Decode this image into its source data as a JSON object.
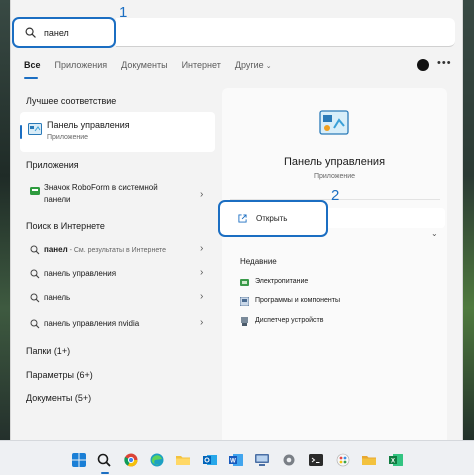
{
  "search": {
    "value": "панел",
    "step_label": "1"
  },
  "tabs": [
    {
      "label": "Все"
    },
    {
      "label": "Приложения"
    },
    {
      "label": "Документы"
    },
    {
      "label": "Интернет"
    },
    {
      "label": "Другие"
    }
  ],
  "more_label": "•••",
  "best_match": {
    "heading": "Лучшее соответствие",
    "title": "Панель управления",
    "subtitle": "Приложение"
  },
  "apps": {
    "heading": "Приложения",
    "items": [
      {
        "label": "Значок RoboForm в системной панели",
        "line1": "Значок RoboForm в системной",
        "line2": "панели"
      }
    ]
  },
  "web": {
    "heading": "Поиск в Интернете",
    "items": [
      {
        "bold": "панел",
        "rest": " - См. результаты в Интернете"
      },
      {
        "bold": "панель управления",
        "rest": ""
      },
      {
        "bold": "панель",
        "rest": ""
      },
      {
        "bold": "панель управления nvidia",
        "rest": ""
      }
    ]
  },
  "categories": [
    {
      "label": "Папки (1+)"
    },
    {
      "label": "Параметры (6+)"
    },
    {
      "label": "Документы (5+)"
    }
  ],
  "detail": {
    "title": "Панель управления",
    "subtitle": "Приложение",
    "open_label": "Открыть",
    "step_label": "2",
    "recent_heading": "Недавние",
    "recent": [
      {
        "label": "Электропитание",
        "icon": "power-icon"
      },
      {
        "label": "Программы и компоненты",
        "icon": "programs-icon"
      },
      {
        "label": "Диспетчер устройств",
        "icon": "device-manager-icon"
      }
    ]
  },
  "taskbar": {
    "apps": [
      "windows-start",
      "search",
      "chrome",
      "edge",
      "file-explorer",
      "outlook",
      "word",
      "remote-desktop",
      "settings",
      "terminal",
      "paint",
      "explorer-alt",
      "excel"
    ]
  },
  "colors": {
    "accent": "#1b6ec2",
    "panel_bg": "#f3f3f3"
  }
}
